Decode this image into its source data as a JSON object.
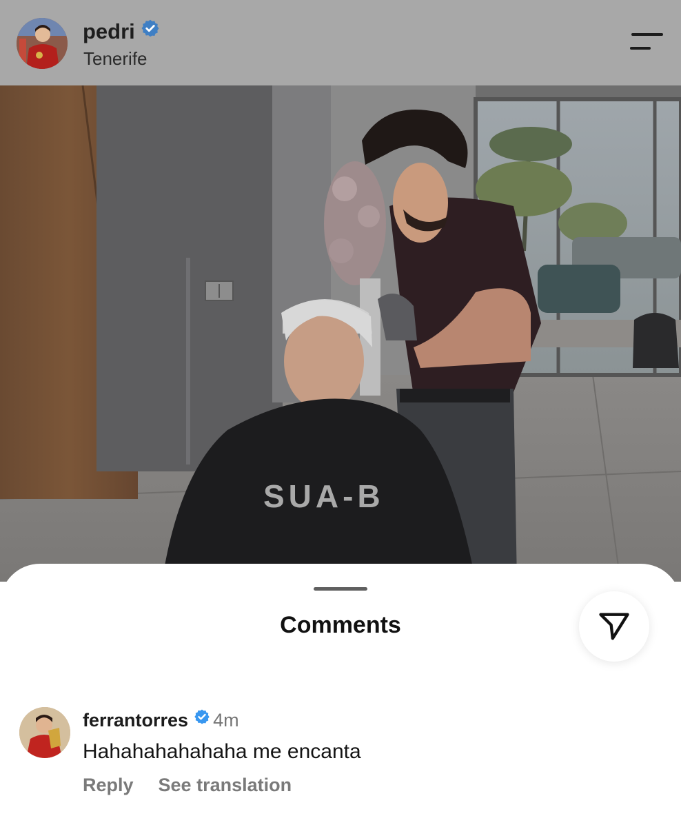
{
  "post": {
    "username": "pedri",
    "location": "Tenerife",
    "photo_cape_text": "SUA-B"
  },
  "icons": {
    "verified": "verified-badge-icon",
    "menu": "menu-icon",
    "send": "send-icon"
  },
  "colors": {
    "verified_blue": "#3897f0",
    "header_overlay": "#a8a8a8"
  },
  "comments_sheet": {
    "title": "Comments",
    "comments": [
      {
        "username": "ferrantorres",
        "time": "4m",
        "text": "Hahahahahahaha me encanta",
        "reply_label": "Reply",
        "translation_label": "See translation"
      }
    ]
  }
}
